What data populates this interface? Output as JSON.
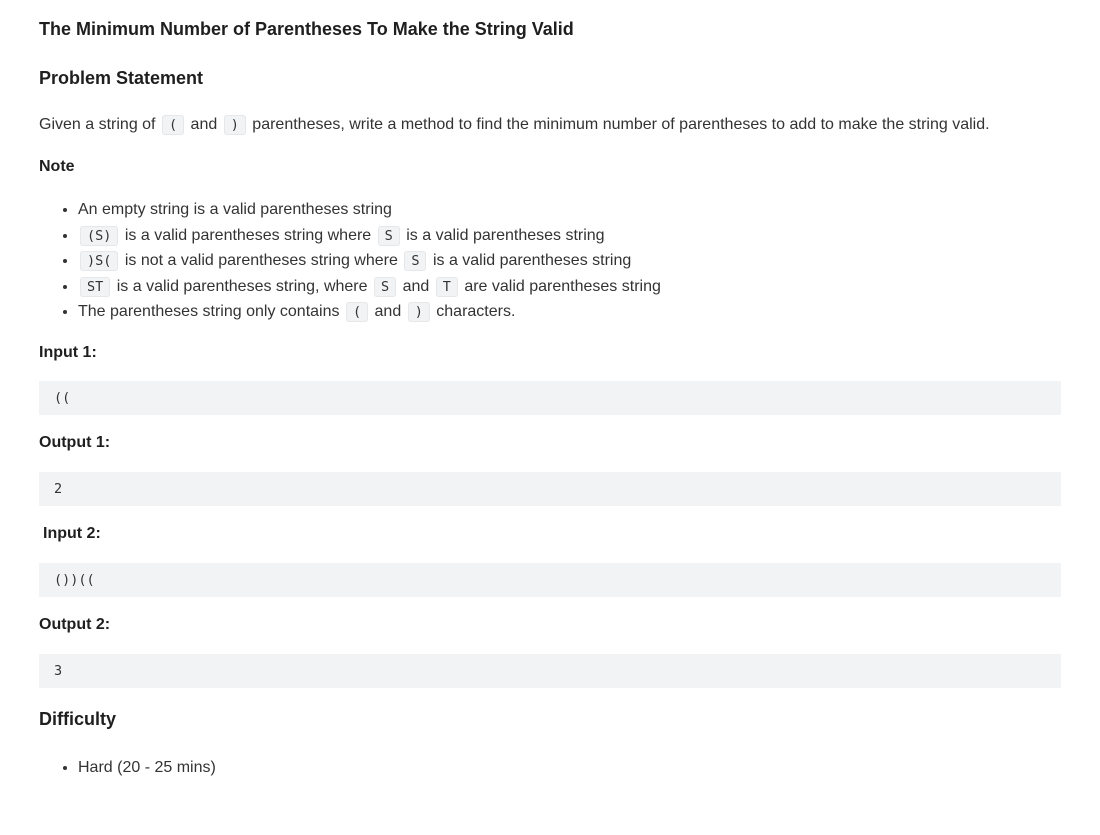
{
  "title": "The Minimum Number of Parentheses To Make the String Valid",
  "problem_statement": {
    "heading": "Problem Statement",
    "p1": "Given a string of",
    "c1": "(",
    "p2": "and",
    "c2": ")",
    "p3": "parentheses, write a method to find the minimum number of parentheses to add to make the string valid."
  },
  "note": {
    "heading": "Note",
    "items": [
      {
        "t1": "An empty string is a valid parentheses string"
      },
      {
        "c1": "(S)",
        "t1": "is a valid parentheses string where",
        "c2": "S",
        "t2": "is a valid parentheses string"
      },
      {
        "c1": ")S(",
        "t1": "is not a valid parentheses string where",
        "c2": "S",
        "t2": "is a valid parentheses string"
      },
      {
        "c1": "ST",
        "t1": "is a valid parentheses string, where",
        "c2": "S",
        "t2": "and",
        "c3": "T",
        "t3": "are valid parentheses string"
      },
      {
        "t1": "The parentheses string only contains",
        "c1": "(",
        "t2": "and",
        "c2": ")",
        "t3": "characters."
      }
    ]
  },
  "examples": [
    {
      "input_label": "Input 1:",
      "input": "((",
      "output_label": "Output 1:",
      "output": "2"
    },
    {
      "input_label": "Input 2:",
      "input": "())((",
      "output_label": "Output 2:",
      "output": "3"
    }
  ],
  "difficulty": {
    "heading": "Difficulty",
    "items": [
      "Hard (20  - 25 mins)"
    ]
  }
}
